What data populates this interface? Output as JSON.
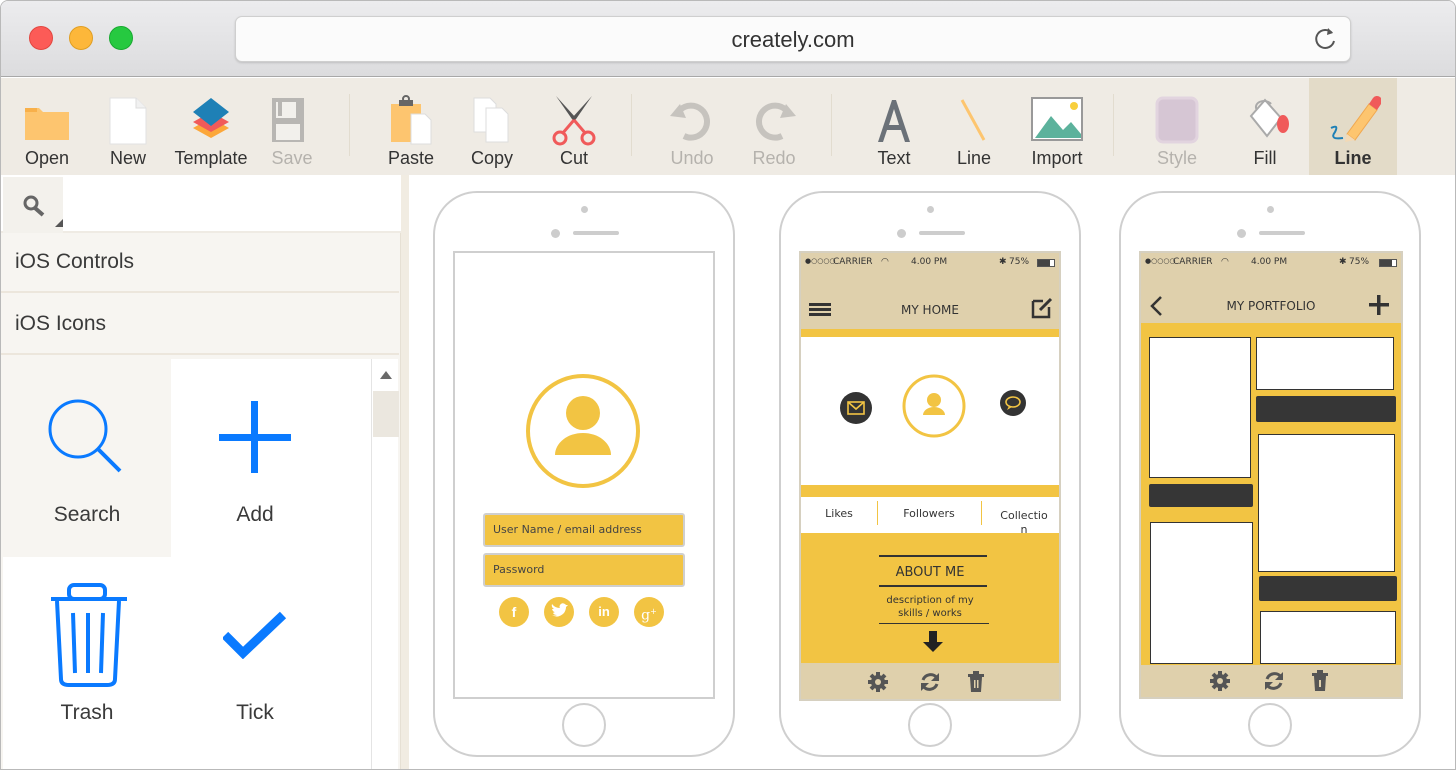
{
  "browser": {
    "url": "creately.com",
    "reload_icon": "reload-icon",
    "window_controls": [
      "close",
      "minimize",
      "maximize"
    ]
  },
  "toolbar": {
    "items": [
      {
        "id": "open",
        "label": "Open",
        "icon": "folder-icon",
        "disabled": false
      },
      {
        "id": "new",
        "label": "New",
        "icon": "new-document-icon",
        "disabled": false
      },
      {
        "id": "template",
        "label": "Template",
        "icon": "layers-icon",
        "disabled": false
      },
      {
        "id": "save",
        "label": "Save",
        "icon": "floppy-disk-icon",
        "disabled": true
      },
      {
        "id": "paste",
        "label": "Paste",
        "icon": "clipboard-icon",
        "disabled": false
      },
      {
        "id": "copy",
        "label": "Copy",
        "icon": "copy-icon",
        "disabled": false
      },
      {
        "id": "cut",
        "label": "Cut",
        "icon": "scissors-icon",
        "disabled": false
      },
      {
        "id": "undo",
        "label": "Undo",
        "icon": "undo-icon",
        "disabled": true
      },
      {
        "id": "redo",
        "label": "Redo",
        "icon": "redo-icon",
        "disabled": true
      },
      {
        "id": "text",
        "label": "Text",
        "icon": "text-icon",
        "disabled": false
      },
      {
        "id": "line",
        "label": "Line",
        "icon": "line-icon",
        "disabled": false
      },
      {
        "id": "import",
        "label": "Import",
        "icon": "image-icon",
        "disabled": false
      },
      {
        "id": "style",
        "label": "Style",
        "icon": "style-swatch-icon",
        "disabled": true
      },
      {
        "id": "fill",
        "label": "Fill",
        "icon": "paint-bucket-icon",
        "disabled": false
      },
      {
        "id": "line-style",
        "label": "Line",
        "icon": "pencil-icon",
        "disabled": false,
        "active": true
      }
    ]
  },
  "sidebar": {
    "search": {
      "value": "",
      "placeholder": ""
    },
    "categories": [
      {
        "label": "iOS Controls"
      },
      {
        "label": "iOS Icons"
      }
    ],
    "icons": [
      {
        "label": "Search",
        "icon": "search-icon",
        "highlighted": true
      },
      {
        "label": "Add",
        "icon": "plus-icon",
        "highlighted": false
      },
      {
        "label": "Trash",
        "icon": "trash-icon",
        "highlighted": false
      },
      {
        "label": "Tick",
        "icon": "checkmark-icon",
        "highlighted": false
      }
    ],
    "icon_color": "#0a7aff"
  },
  "canvas": {
    "accent_yellow": "#f2c443",
    "accent_beige": "#dfd0ac",
    "phones": [
      {
        "screen": "login",
        "fields": [
          {
            "placeholder": "User Name / email address"
          },
          {
            "placeholder": "Password"
          }
        ],
        "social": [
          "f",
          "t",
          "in",
          "g+"
        ]
      },
      {
        "screen": "home",
        "status": {
          "carrier": "CARRIER",
          "time": "4.00 PM",
          "battery": "75%"
        },
        "title": "MY HOME",
        "tabs": [
          "Likes",
          "Followers",
          "Collection"
        ],
        "about_title": "ABOUT ME",
        "about_text_1": "description of my",
        "about_text_2": "skills / works"
      },
      {
        "screen": "portfolio",
        "status": {
          "carrier": "CARRIER",
          "time": "4.00 PM",
          "battery": "75%"
        },
        "title": "MY PORTFOLIO"
      }
    ]
  }
}
